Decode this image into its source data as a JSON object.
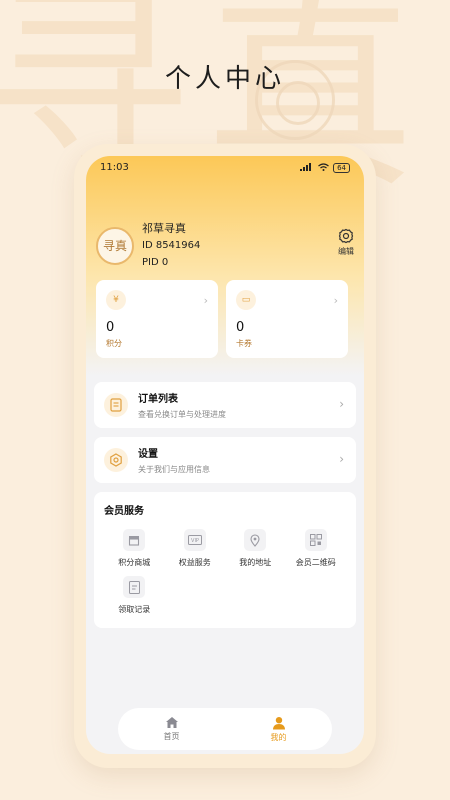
{
  "poster": {
    "title": "个人中心",
    "bg_glyphs": [
      "寻",
      "真"
    ]
  },
  "status_bar": {
    "time": "11:03",
    "signal": "HD",
    "battery": "64"
  },
  "profile": {
    "avatar_text": "寻真",
    "name": "祁草寻真",
    "id": "ID 8541964",
    "pid": "PID 0",
    "edit_label": "编辑"
  },
  "stats": [
    {
      "icon": "yen-icon",
      "icon_glyph": "¥",
      "value": "0",
      "label": "积分"
    },
    {
      "icon": "ticket-icon",
      "icon_glyph": "▭",
      "value": "0",
      "label": "卡券"
    }
  ],
  "menu": [
    {
      "title": "订单列表",
      "subtitle": "查看兑换订单与处理进度",
      "icon": "order-list-icon"
    },
    {
      "title": "设置",
      "subtitle": "关于我们与应用信息",
      "icon": "settings-icon"
    }
  ],
  "services": {
    "title": "会员服务",
    "items": [
      {
        "label": "积分商城",
        "icon": "store-icon"
      },
      {
        "label": "权益服务",
        "icon": "vip-icon"
      },
      {
        "label": "我的地址",
        "icon": "location-icon"
      },
      {
        "label": "会员二维码",
        "icon": "qrcode-icon"
      },
      {
        "label": "领取记录",
        "icon": "record-icon"
      }
    ]
  },
  "tabbar": {
    "items": [
      {
        "label": "首页",
        "icon": "home-icon",
        "active": false
      },
      {
        "label": "我的",
        "icon": "user-icon",
        "active": true
      }
    ],
    "active_color": "#e69a1c"
  },
  "colors": {
    "accent": "#fcc857",
    "label_brown": "#b3772d",
    "page_bg": "#fbeedd"
  }
}
